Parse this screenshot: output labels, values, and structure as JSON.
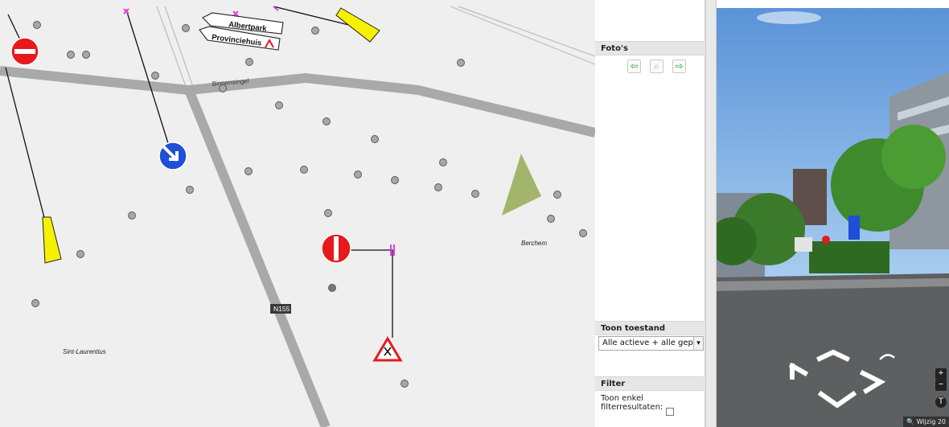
{
  "map": {
    "labels": {
      "road1": "Binnensingel",
      "road_number": "N155",
      "place1": "Berchem",
      "place2": "Sint-Laurentius",
      "sign_top": "Albertpark",
      "sign_bottom": "Provinciehuis"
    }
  },
  "panel": {
    "photos_title": "Foto's",
    "photo_prev_icon": "⇦",
    "photo_zoom_icon": "⌕",
    "photo_next_icon": "⇨",
    "state_title": "Toon toestand",
    "state_value": "Alle actieve + alle geplande",
    "filter_title": "Filter",
    "filter_label": "Toon enkel filterresultaten:",
    "filter_checked": false
  },
  "streetview": {
    "zoom_in": "+",
    "zoom_out": "−",
    "badge": "🔍 Wijzig 20"
  },
  "colors": {
    "map_bg": "#efefef",
    "road": "#a8a8a8",
    "sign_red": "#e8191b",
    "sign_blue": "#1f4fd6",
    "yellow": "#f6f100",
    "green": "#a3b56a",
    "magenta": "#e040e0"
  }
}
